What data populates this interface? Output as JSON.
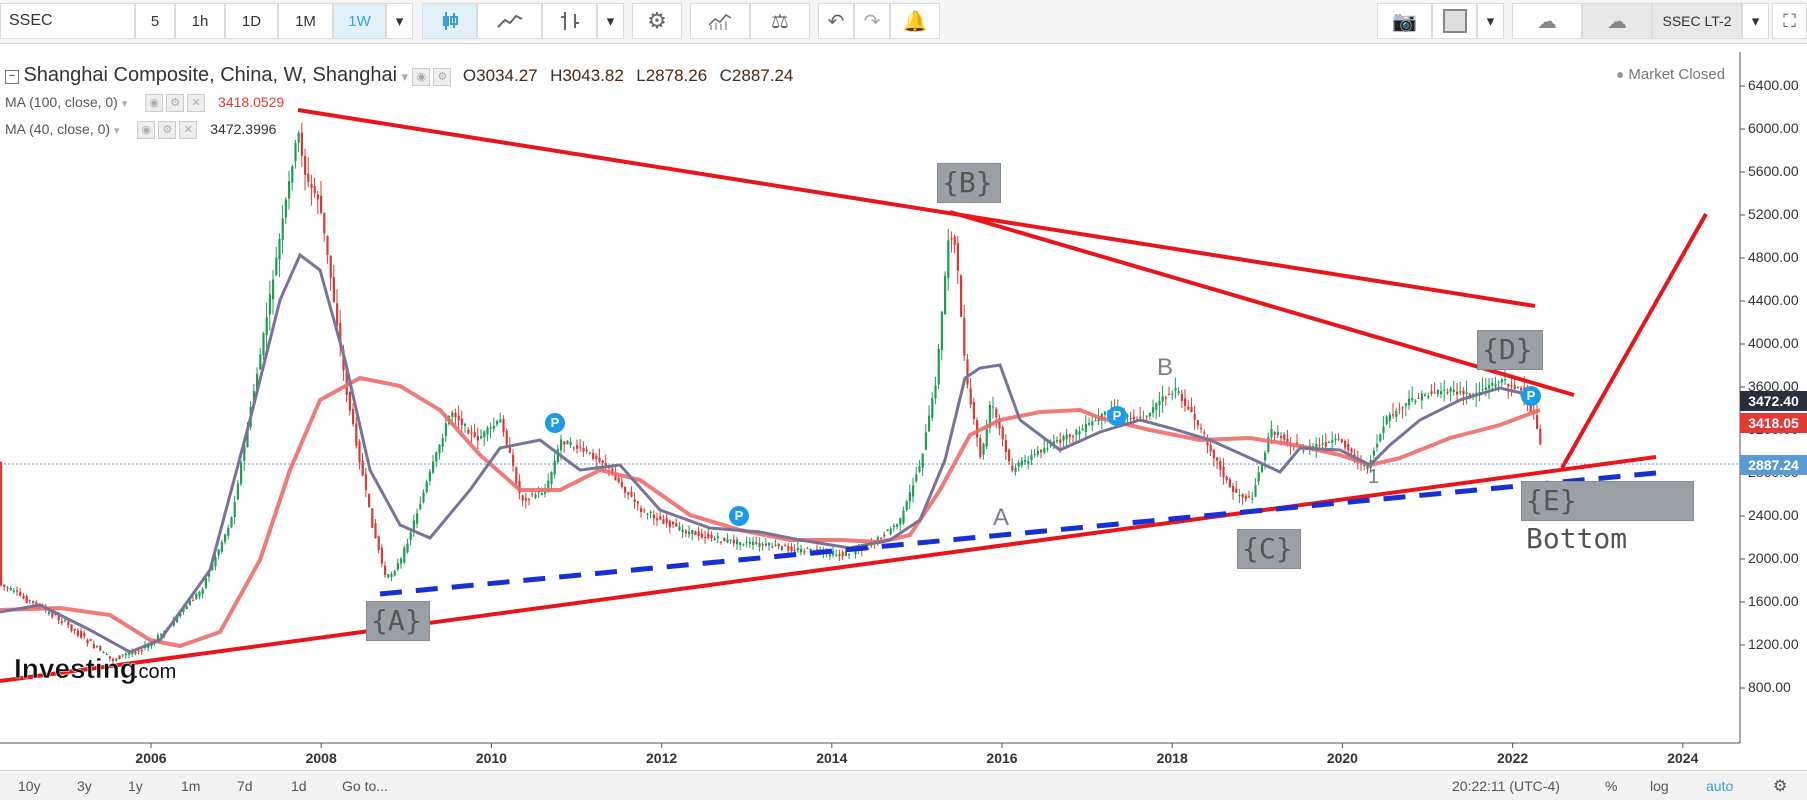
{
  "toolbar": {
    "symbol": "SSEC",
    "intervals": [
      "5",
      "1h",
      "1D",
      "1M",
      "1W"
    ],
    "active_interval": "1W",
    "layout": "SSEC LT-2"
  },
  "legend": {
    "title": "Shanghai Composite, China, W, Shanghai",
    "o_label": "O",
    "o": "3034.27",
    "h_label": "H",
    "h": "3043.82",
    "l_label": "L",
    "l": "2878.26",
    "c_label": "C",
    "c": "2887.24",
    "market_status": "Market Closed",
    "ma100_label": "MA (100, close, 0)",
    "ma100_value": "3418.0529",
    "ma40_label": "MA (40, close, 0)",
    "ma40_value": "3472.3996"
  },
  "watermark": {
    "brand": "Investing",
    "suffix": ".com"
  },
  "price_axis": {
    "labels": [
      "6400.00",
      "6000.00",
      "5600.00",
      "5200.00",
      "4800.00",
      "4400.00",
      "4000.00",
      "3600.00",
      "3200.00",
      "2800.00",
      "2400.00",
      "2000.00",
      "1600.00",
      "1200.00",
      "800.00"
    ],
    "badges": [
      {
        "text": "3472.40",
        "color": "#2a2e39"
      },
      {
        "text": "3418.05",
        "color": "#e53935"
      },
      {
        "text": "2887.24",
        "color": "#5a9bd6"
      }
    ]
  },
  "time_axis": {
    "labels": [
      "2006",
      "2008",
      "2010",
      "2012",
      "2014",
      "2016",
      "2018",
      "2020",
      "2022",
      "2024"
    ]
  },
  "annotations": {
    "A_box": "{A}",
    "B_box": "{B}",
    "C_box": "{C}",
    "D_box": "{D}",
    "E_box": "{E} Bottom",
    "letter_A": "A",
    "letter_B": "B",
    "letter_1": "1"
  },
  "p_markers": [
    "P",
    "P",
    "P",
    "P"
  ],
  "bottom": {
    "ranges": [
      "10y",
      "3y",
      "1y",
      "1m",
      "7d",
      "1d"
    ],
    "goto": "Go to...",
    "time": "20:22:11 (UTC-4)",
    "percent": "%",
    "log": "log",
    "auto": "auto"
  },
  "colors": {
    "trendline": "#e8161b",
    "dashed": "#1730d6",
    "ma40": "#7a7398",
    "ma100": "#f06b6b",
    "up": "#1e9c5a",
    "down": "#d83a3a"
  }
}
